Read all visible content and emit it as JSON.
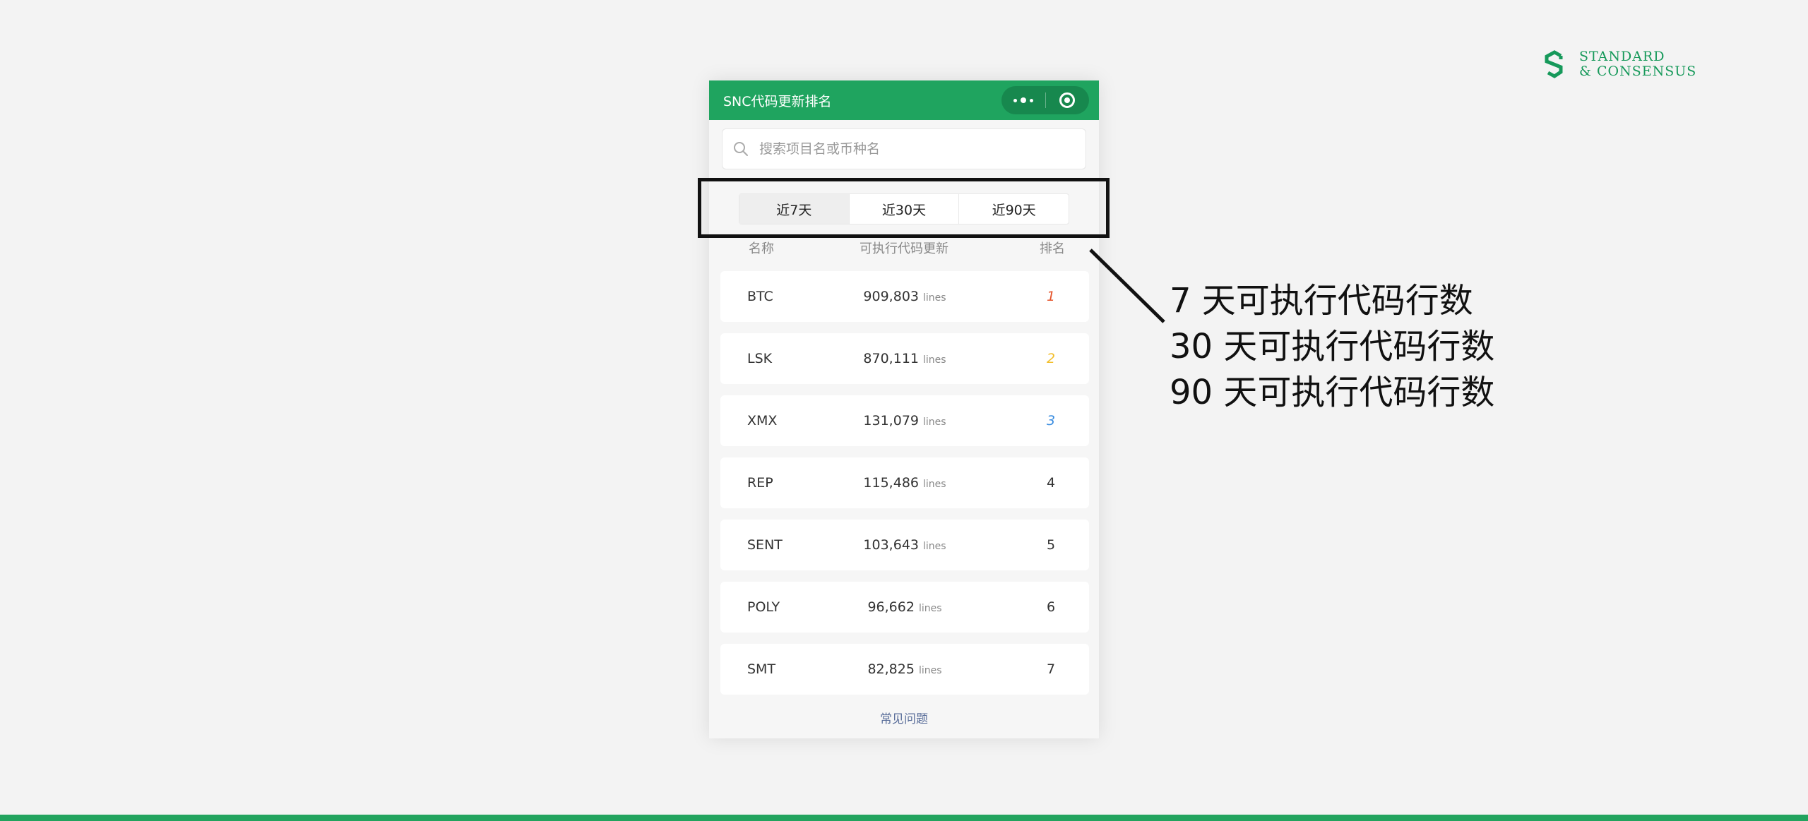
{
  "brand": {
    "line1": "STANDARD",
    "line2": "& CONSENSUS",
    "accent_color": "#16995a",
    "icon": "s-logo-icon"
  },
  "app": {
    "title": "SNC代码更新排名",
    "header_color": "#1fa45f",
    "capsule": {
      "more_icon": "more-dots-icon",
      "close_icon": "target-icon"
    }
  },
  "search": {
    "placeholder": "搜索项目名或币种名",
    "value": "",
    "icon": "search-icon"
  },
  "tabs": [
    {
      "label": "近7天",
      "active": true
    },
    {
      "label": "近30天",
      "active": false
    },
    {
      "label": "近90天",
      "active": false
    }
  ],
  "columns": {
    "name": "名称",
    "updates": "可执行代码更新",
    "rank": "排名"
  },
  "rows": [
    {
      "name": "BTC",
      "value": "909,803",
      "unit": "lines",
      "rank": "1"
    },
    {
      "name": "LSK",
      "value": "870,111",
      "unit": "lines",
      "rank": "2"
    },
    {
      "name": "XMX",
      "value": "131,079",
      "unit": "lines",
      "rank": "3"
    },
    {
      "name": "REP",
      "value": "115,486",
      "unit": "lines",
      "rank": "4"
    },
    {
      "name": "SENT",
      "value": "103,643",
      "unit": "lines",
      "rank": "5"
    },
    {
      "name": "POLY",
      "value": "96,662",
      "unit": "lines",
      "rank": "6"
    },
    {
      "name": "SMT",
      "value": "82,825",
      "unit": "lines",
      "rank": "7"
    }
  ],
  "rank_colors": {
    "1": "#e5532a",
    "2": "#f2bf2e",
    "3": "#3d8ee0"
  },
  "footer": {
    "faq": "常见问题"
  },
  "annotation": {
    "lines": [
      "7 天可执行代码行数",
      "30 天可执行代码行数",
      "90 天可执行代码行数"
    ]
  }
}
